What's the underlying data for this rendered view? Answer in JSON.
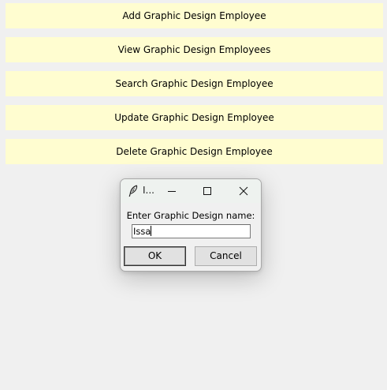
{
  "colors": {
    "background": "#f0f0f0",
    "menu_button_bg": "#fffdd0",
    "dialog_title_bg": "#eef2ef"
  },
  "menu_buttons": [
    {
      "label": "Add Graphic Design Employee"
    },
    {
      "label": "View Graphic Design Employees"
    },
    {
      "label": "Search Graphic Design Employee"
    },
    {
      "label": "Update Graphic Design Employee"
    },
    {
      "label": "Delete Graphic Design Employee"
    }
  ],
  "dialog": {
    "title": "I...",
    "icon": "feather-icon",
    "prompt": "Enter Graphic Design name:",
    "input_value": "Issa",
    "ok_label": "OK",
    "cancel_label": "Cancel"
  }
}
